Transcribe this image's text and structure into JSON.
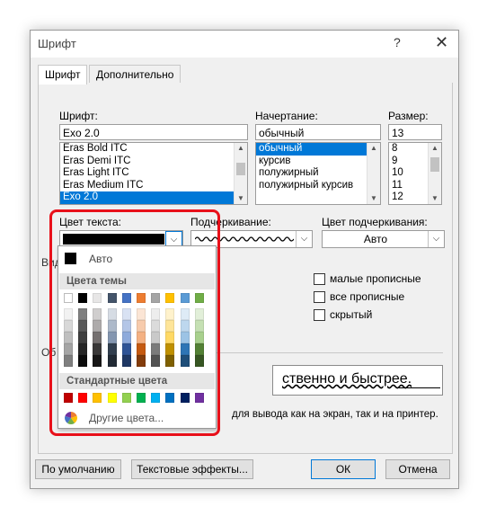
{
  "window": {
    "title": "Шрифт",
    "help_glyph": "?",
    "close_glyph": "✕"
  },
  "tabs": [
    {
      "label": "Шрифт",
      "active": true
    },
    {
      "label": "Дополнительно",
      "active": false
    }
  ],
  "font": {
    "label": "Шрифт:",
    "value": "Exo 2.0",
    "list": [
      "Eras Bold ITC",
      "Eras Demi ITC",
      "Eras Light ITC",
      "Eras Medium ITC",
      "Exo 2.0"
    ],
    "selected": "Exo 2.0"
  },
  "style": {
    "label": "Начертание:",
    "value": "обычный",
    "list": [
      "обычный",
      "курсив",
      "полужирный",
      "полужирный курсив"
    ],
    "selected": "обычный"
  },
  "size": {
    "label": "Размер:",
    "value": "13",
    "list": [
      "8",
      "9",
      "10",
      "11",
      "12"
    ]
  },
  "text_color": {
    "label": "Цвет текста:",
    "value_color": "#000000"
  },
  "underline": {
    "label": "Подчеркивание:"
  },
  "underline_color": {
    "label": "Цвет подчеркивания:",
    "value": "Авто"
  },
  "effects": {
    "partial_label_left": "Вид",
    "partial_label_preview": "Об",
    "small_caps": "малые прописные",
    "all_caps": "все прописные",
    "hidden": "скрытый"
  },
  "preview": {
    "visible_text": "ственно и быстрее.",
    "note": "для вывода как на экран, так и на принтер."
  },
  "buttons": {
    "default": "По умолчанию",
    "text_effects": "Текстовые эффекты...",
    "ok": "ОК",
    "cancel": "Отмена"
  },
  "color_picker": {
    "auto_label": "Авто",
    "auto_color": "#000000",
    "theme_header": "Цвета темы",
    "theme_base": [
      "#ffffff",
      "#000000",
      "#e7e6e6",
      "#44546a",
      "#4472c4",
      "#ed7d31",
      "#a5a5a5",
      "#ffc000",
      "#5b9bd5",
      "#70ad47"
    ],
    "theme_shades": [
      [
        "#f2f2f2",
        "#7f7f7f",
        "#d0cece",
        "#d6dce4",
        "#d9e2f3",
        "#fbe5d5",
        "#ededed",
        "#fff2cc",
        "#deebf6",
        "#e2efd9"
      ],
      [
        "#d8d8d8",
        "#595959",
        "#aeabab",
        "#adb9ca",
        "#b4c6e7",
        "#f7cbac",
        "#dbdbdb",
        "#fee599",
        "#bdd7ee",
        "#c5e0b3"
      ],
      [
        "#bfbfbf",
        "#3f3f3f",
        "#757070",
        "#8496b0",
        "#8eaadb",
        "#f4b183",
        "#c9c9c9",
        "#ffd965",
        "#9cc3e5",
        "#a8d08d"
      ],
      [
        "#a5a5a5",
        "#262626",
        "#3a3838",
        "#323f4f",
        "#2f5496",
        "#c55a11",
        "#7b7b7b",
        "#bf9000",
        "#2e75b5",
        "#538135"
      ],
      [
        "#7f7f7f",
        "#0c0c0c",
        "#171616",
        "#222a35",
        "#1f3864",
        "#833c0b",
        "#525252",
        "#7f6000",
        "#1f4e79",
        "#375623"
      ]
    ],
    "standard_header": "Стандартные цвета",
    "standard": [
      "#c00000",
      "#ff0000",
      "#ffc000",
      "#ffff00",
      "#92d050",
      "#00b050",
      "#00b0f0",
      "#0070c0",
      "#002060",
      "#7030a0"
    ],
    "more_label": "Другие цвета..."
  },
  "highlight_color": "#e8101a",
  "accent_color": "#0078d7"
}
